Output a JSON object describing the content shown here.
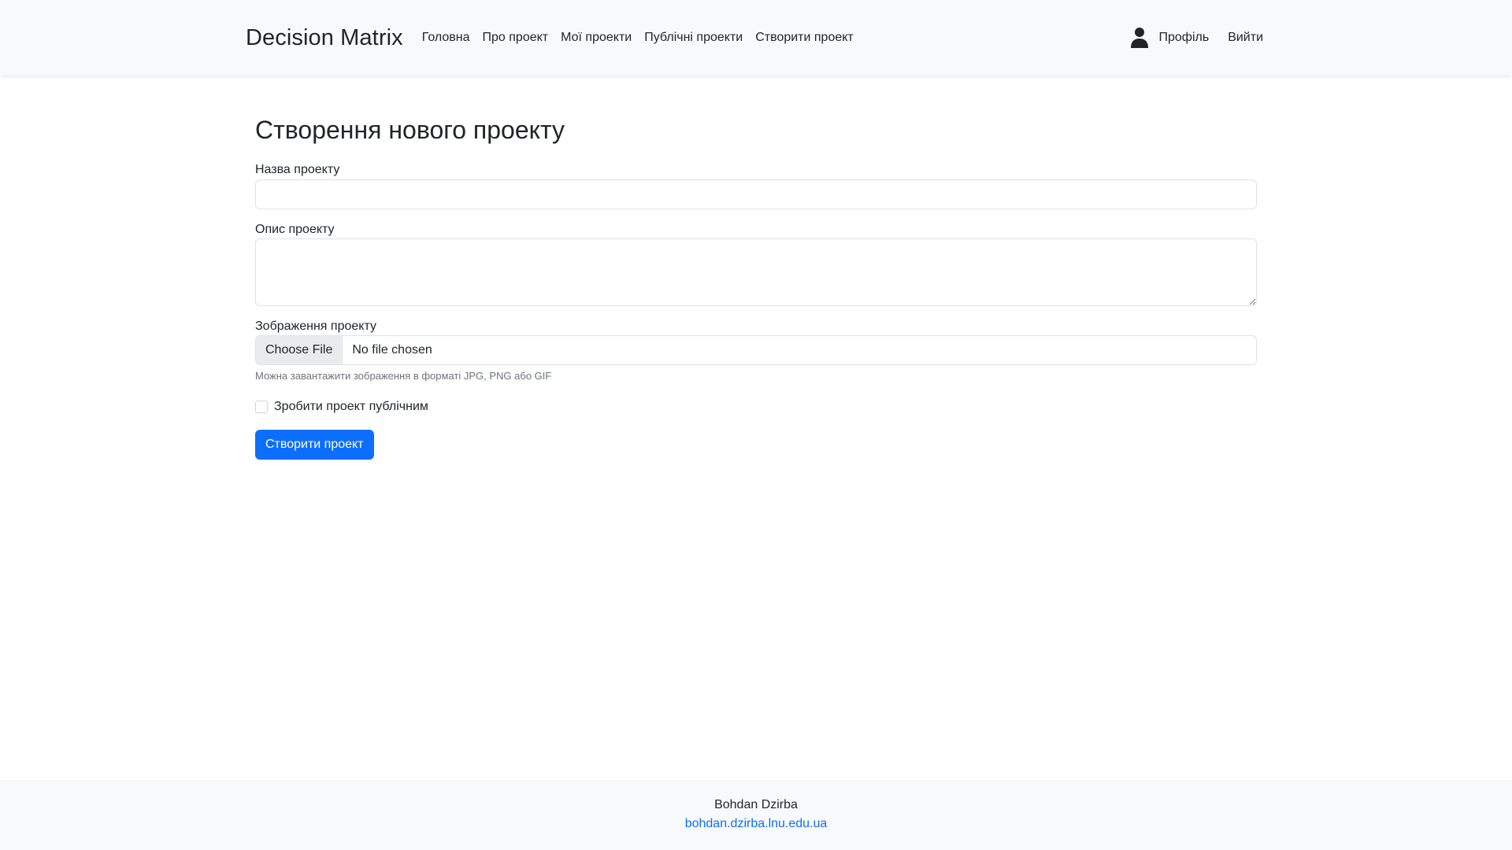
{
  "navbar": {
    "brand": "Decision Matrix",
    "links": [
      {
        "label": "Головна"
      },
      {
        "label": "Про проект"
      },
      {
        "label": "Мої проекти"
      },
      {
        "label": "Публічні проекти"
      },
      {
        "label": "Створити проект"
      }
    ],
    "profile_label": "Профіль",
    "profile_icon": "user-icon",
    "logout_label": "Вийти"
  },
  "form": {
    "title": "Створення нового проекту",
    "name_label": "Назва проекту",
    "name_value": "",
    "description_label": "Опис проекту",
    "description_value": "",
    "image_label": "Зображення проекту",
    "file_button_label": "Choose File",
    "file_status": "No file chosen",
    "image_help": "Можна завантажити зображення в форматі JPG, PNG або GIF",
    "public_label": "Зробити проект публічним",
    "public_checked": false,
    "submit_label": "Створити проект"
  },
  "footer": {
    "author": "Bohdan Dzirba",
    "link": "bohdan.dzirba.lnu.edu.ua"
  },
  "colors": {
    "primary": "#0d6efd",
    "navbar_bg": "#f8f9fa",
    "text": "#212529",
    "muted": "#6c757d"
  }
}
